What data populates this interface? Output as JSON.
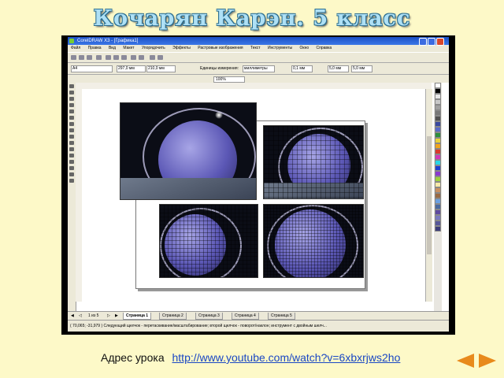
{
  "slide": {
    "title": "Кочарян Карэн. 5 класс",
    "footer_label": "Адрес урока",
    "footer_link": "http://www.youtube.com/watch?v=6xbxrjws2ho",
    "nav_back_icon": "back-triangle-icon",
    "nav_forward_icon": "forward-triangle-icon",
    "accent_color": "#e88a1c"
  },
  "app": {
    "title": "CorelDRAW X3 - [Графика1]",
    "menu": [
      "Файл",
      "Правка",
      "Вид",
      "Макет",
      "Упорядочить",
      "Эффекты",
      "Растровые изображения",
      "Текст",
      "Инструменты",
      "Окно",
      "Справка"
    ],
    "property_bar": {
      "paper": "A4",
      "width": "297,0 мм",
      "height": "210,0 мм",
      "units_label": "Единицы измерения:",
      "units": "миллиметры",
      "nudge": "0,1 мм",
      "dup_x": "5,0 мм",
      "dup_y": "5,0 мм"
    },
    "zoom": "100%",
    "pages": {
      "counter": "1 из 5",
      "tabs": [
        "Страница 1",
        "Страница 2",
        "Страница 3",
        "Страница 4",
        "Страница 5"
      ],
      "active_index": 0
    },
    "status_text": "( 70,065; -31,979 )    Следующий щелчок - перетаскивание/масштабирование; второй щелчок - поворот/наклон; инструмент с двойным шелч..."
  }
}
